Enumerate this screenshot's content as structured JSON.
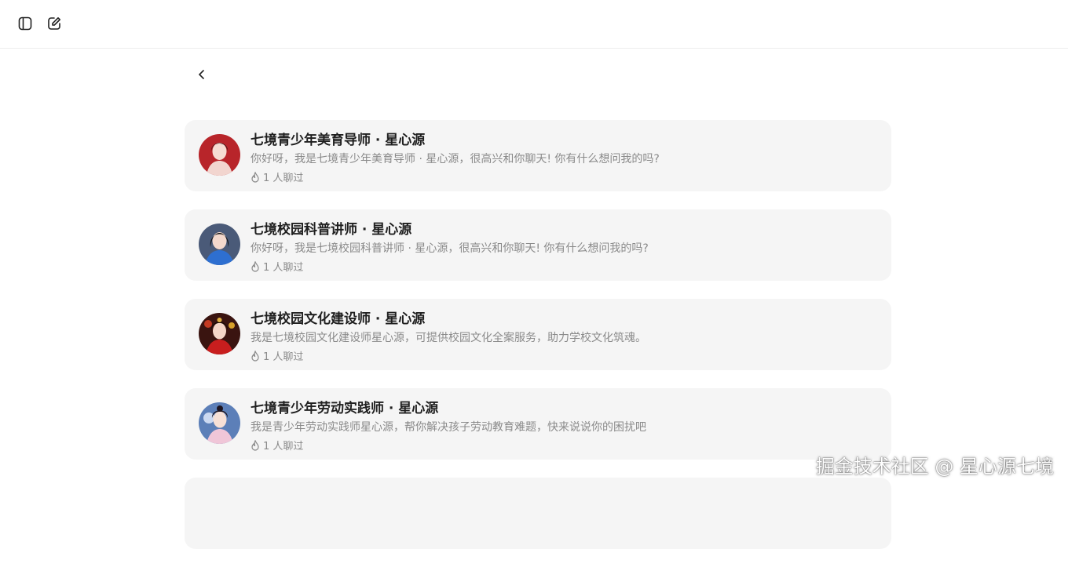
{
  "toolbar": {
    "sidebar_toggle_icon": "sidebar-toggle-icon",
    "new_chat_icon": "edit-icon"
  },
  "back_icon": "chevron-left-icon",
  "agents": [
    {
      "name": "七境青少年美育导师 · 星心源",
      "description": "你好呀，我是七境青少年美育导师 · 星心源，很高兴和你聊天! 你有什么想问我的吗?",
      "chat_count": "1 人聊过",
      "avatar_bg": "#b8252a"
    },
    {
      "name": "七境校园科普讲师 · 星心源",
      "description": "你好呀，我是七境校园科普讲师 · 星心源，很高兴和你聊天! 你有什么想问我的吗?",
      "chat_count": "1 人聊过",
      "avatar_bg": "#4a5a78"
    },
    {
      "name": "七境校园文化建设师 · 星心源",
      "description": "我是七境校园文化建设师星心源，可提供校园文化全案服务，助力学校文化筑魂。",
      "chat_count": "1 人聊过",
      "avatar_bg": "#3a1410"
    },
    {
      "name": "七境青少年劳动实践师 · 星心源",
      "description": "我是青少年劳动实践师星心源，帮你解决孩子劳动教育难题，快来说说你的困扰吧",
      "chat_count": "1 人聊过",
      "avatar_bg": "#5c7fb8"
    }
  ],
  "watermark": "掘金技术社区 @ 星心源七境"
}
